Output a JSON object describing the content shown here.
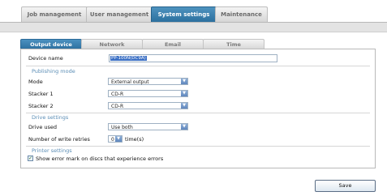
{
  "top_tabs": [
    {
      "label": "Job management",
      "active": false
    },
    {
      "label": "User management",
      "active": false
    },
    {
      "label": "System settings",
      "active": true
    },
    {
      "label": "Maintenance",
      "active": false
    }
  ],
  "sub_tabs": [
    {
      "label": "Output device",
      "active": true
    },
    {
      "label": "Network",
      "active": false
    },
    {
      "label": "Email",
      "active": false
    },
    {
      "label": "Time",
      "active": false
    }
  ],
  "device_name": {
    "label": "Device name",
    "value": "PP-100N(DC9A)"
  },
  "publishing_mode": {
    "title": "Publishing mode",
    "mode": {
      "label": "Mode",
      "value": "External output"
    },
    "stacker1": {
      "label": "Stacker 1",
      "value": "CD-R"
    },
    "stacker2": {
      "label": "Stacker 2",
      "value": "CD-R"
    }
  },
  "drive_settings": {
    "title": "Drive settings",
    "drive_used": {
      "label": "Drive used",
      "value": "Use both"
    },
    "write_retries": {
      "label": "Number of write retries",
      "value": "0",
      "unit": "time(s)"
    }
  },
  "printer_settings": {
    "title": "Printer settings",
    "error_mark": {
      "label": "Show error mark on discs that experience errors",
      "checked": true
    }
  },
  "save_label": "Save",
  "colors": {
    "accent": "#2a6e9d",
    "section_title": "#5b8db5"
  }
}
